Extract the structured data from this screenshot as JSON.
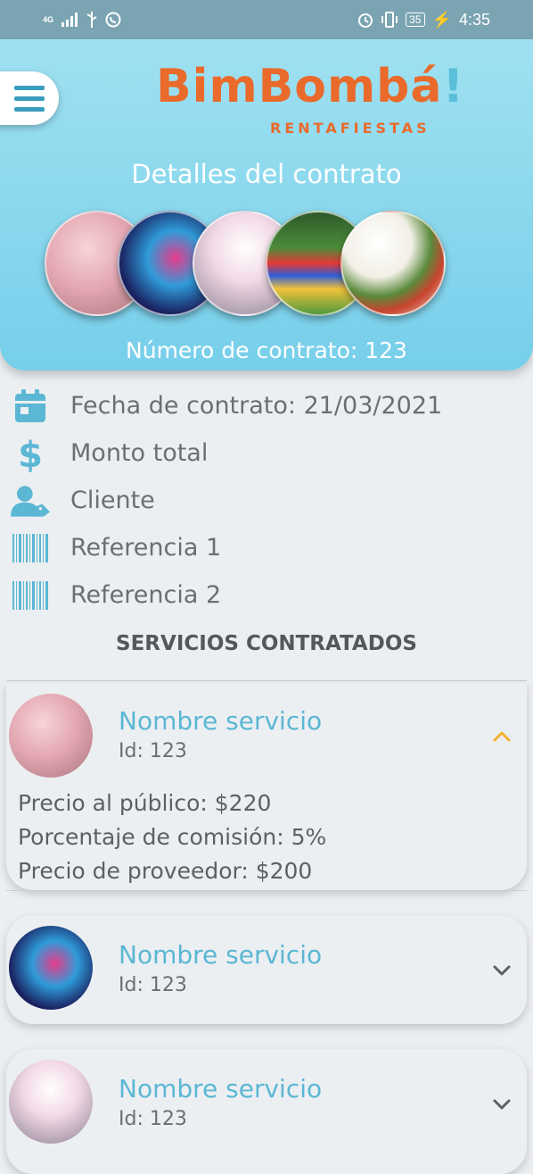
{
  "status_bar": {
    "network": "4G",
    "battery": "35",
    "time": "4:35"
  },
  "header": {
    "logo_main": "BimBombá",
    "logo_bang": "!",
    "logo_sub": "RENTAFIESTAS",
    "title": "Detalles del contrato",
    "contract_number": "Número de contrato: 123",
    "photos": [
      "cake",
      "pinata",
      "decoration",
      "bounce-house",
      "food"
    ]
  },
  "info": {
    "items": [
      {
        "icon": "calendar-icon",
        "label": "Fecha de contrato: 21/03/2021"
      },
      {
        "icon": "dollar-icon",
        "label": "Monto total"
      },
      {
        "icon": "client-icon",
        "label": "Cliente"
      },
      {
        "icon": "barcode-icon",
        "label": "Referencia 1"
      },
      {
        "icon": "barcode-icon",
        "label": "Referencia 2"
      }
    ]
  },
  "services": {
    "title": "SERVICIOS CONTRATADOS",
    "items": [
      {
        "name": "Nombre servicio",
        "id": "Id: 123",
        "expanded": true,
        "details": [
          "Precio al público: $220",
          "Porcentaje de comisión: 5%",
          "Precio de proveedor: $200"
        ]
      },
      {
        "name": "Nombre servicio",
        "id": "Id: 123",
        "expanded": false
      },
      {
        "name": "Nombre servicio",
        "id": "Id: 123",
        "expanded": false
      }
    ]
  },
  "colors": {
    "header_top": "#9fe1f1",
    "header_bottom": "#77cfea",
    "accent_blue": "#5bb7d4",
    "logo_orange": "#ea6a2b",
    "chevron_up": "#f2b32c",
    "chevron_down": "#5d6064"
  }
}
